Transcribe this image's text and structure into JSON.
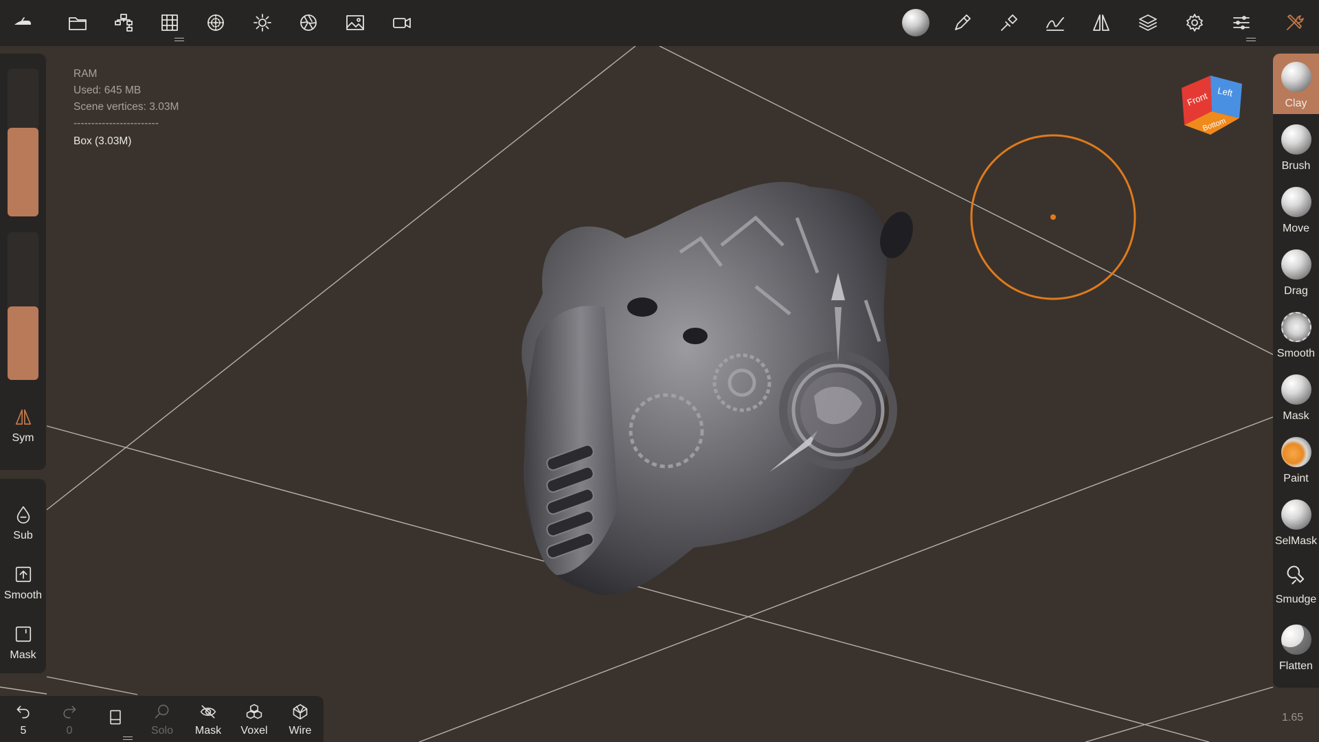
{
  "topbar": {
    "left_icons": [
      "app-logo-icon",
      "folder-icon",
      "scene-tree-icon",
      "grid-icon",
      "matcap-icon",
      "light-icon",
      "camera-shutter-icon",
      "image-icon",
      "video-icon"
    ],
    "right_icons": [
      "material-sphere-icon",
      "pen-icon",
      "brush-settings-icon",
      "stroke-icon",
      "symmetry-icon",
      "layers-icon",
      "settings-icon",
      "sliders-icon",
      "tools-icon"
    ]
  },
  "ram_info": {
    "title": "RAM",
    "used": "Used: 645 MB",
    "vertices": "Scene vertices: 3.03M",
    "separator": "------------------------",
    "object": "Box (3.03M)"
  },
  "left_panel": {
    "sliders": [
      {
        "name": "radius",
        "level": 0.6
      },
      {
        "name": "intensity",
        "level": 0.5
      }
    ],
    "sym_label": "Sym",
    "tools": [
      {
        "label": "Sub",
        "icon": "drop-icon"
      },
      {
        "label": "Smooth",
        "icon": "upload-box-icon"
      },
      {
        "label": "Mask",
        "icon": "mask-box-icon"
      }
    ]
  },
  "bottombar": {
    "undo_count": "5",
    "redo_count": "0",
    "solo_label": "Solo",
    "mask_label": "Mask",
    "voxel_label": "Voxel",
    "wire_label": "Wire"
  },
  "right_tools": [
    {
      "label": "Clay",
      "active": true
    },
    {
      "label": "Brush",
      "active": false
    },
    {
      "label": "Move",
      "active": false
    },
    {
      "label": "Drag",
      "active": false
    },
    {
      "label": "Smooth",
      "active": false
    },
    {
      "label": "Mask",
      "active": false
    },
    {
      "label": "Paint",
      "active": false
    },
    {
      "label": "SelMask",
      "active": false
    },
    {
      "label": "Smudge",
      "active": false
    },
    {
      "label": "Flatten",
      "active": false
    }
  ],
  "viewcube": {
    "front": "Front",
    "left": "Left",
    "bottom": "Bottom"
  },
  "zoom": "1.65",
  "colors": {
    "accent": "#b97a5a",
    "brush_cursor": "#e07b1c",
    "background": "#3a332d",
    "panel": "#272523"
  }
}
